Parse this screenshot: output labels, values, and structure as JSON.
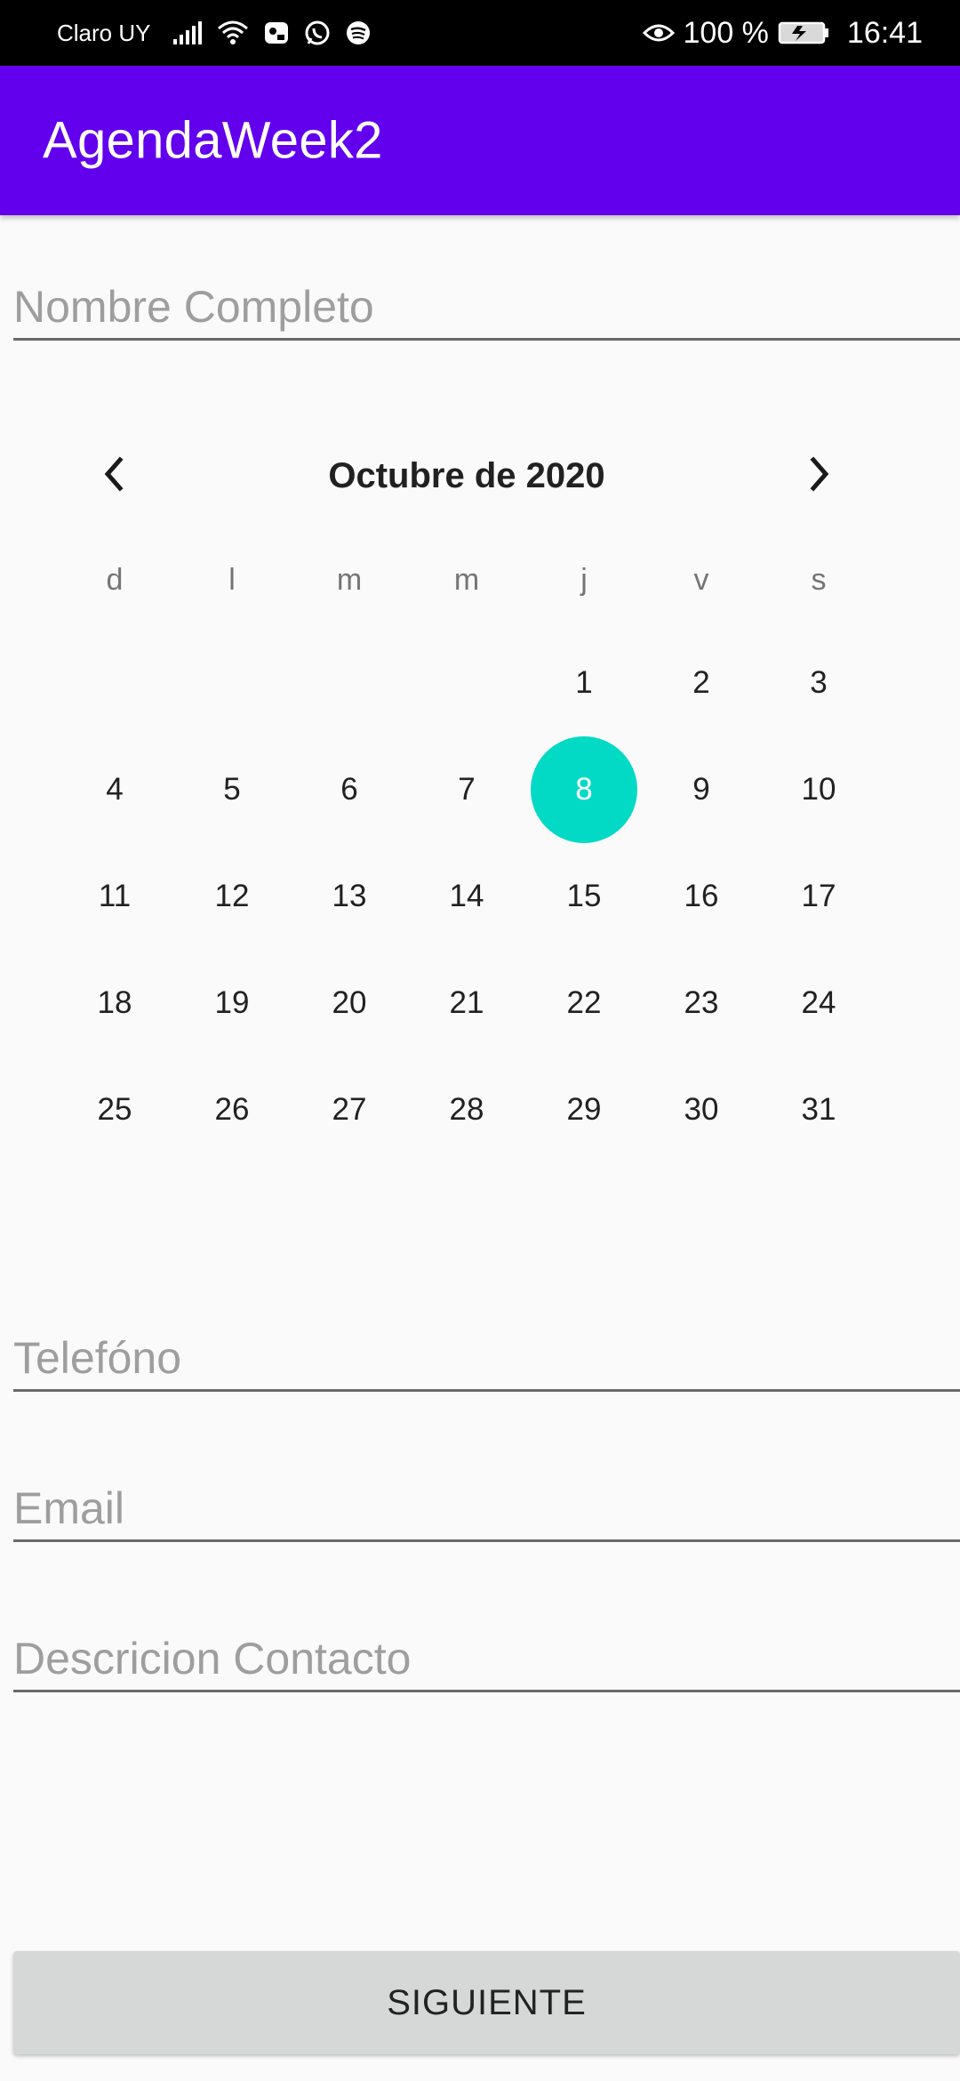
{
  "status_bar": {
    "carrier": "Claro UY",
    "battery_percent": "100 %",
    "time": "16:41",
    "icons": [
      "signal-icon",
      "wifi-icon",
      "notification-app-icon",
      "whatsapp-icon",
      "spotify-icon",
      "eye-icon",
      "battery-icon"
    ]
  },
  "app_bar": {
    "title": "AgendaWeek2",
    "color": "#6200ee"
  },
  "form": {
    "name_placeholder": "Nombre Completo",
    "phone_placeholder": "Telefóno",
    "email_placeholder": "Email",
    "description_placeholder": "Descricion Contacto"
  },
  "calendar": {
    "month_label": "Octubre de 2020",
    "weekdays": [
      "d",
      "l",
      "m",
      "m",
      "j",
      "v",
      "s"
    ],
    "first_weekday_index": 4,
    "days_in_month": 31,
    "selected_day": 8,
    "selected_color": "#03dac5"
  },
  "button": {
    "label": "SIGUIENTE"
  }
}
